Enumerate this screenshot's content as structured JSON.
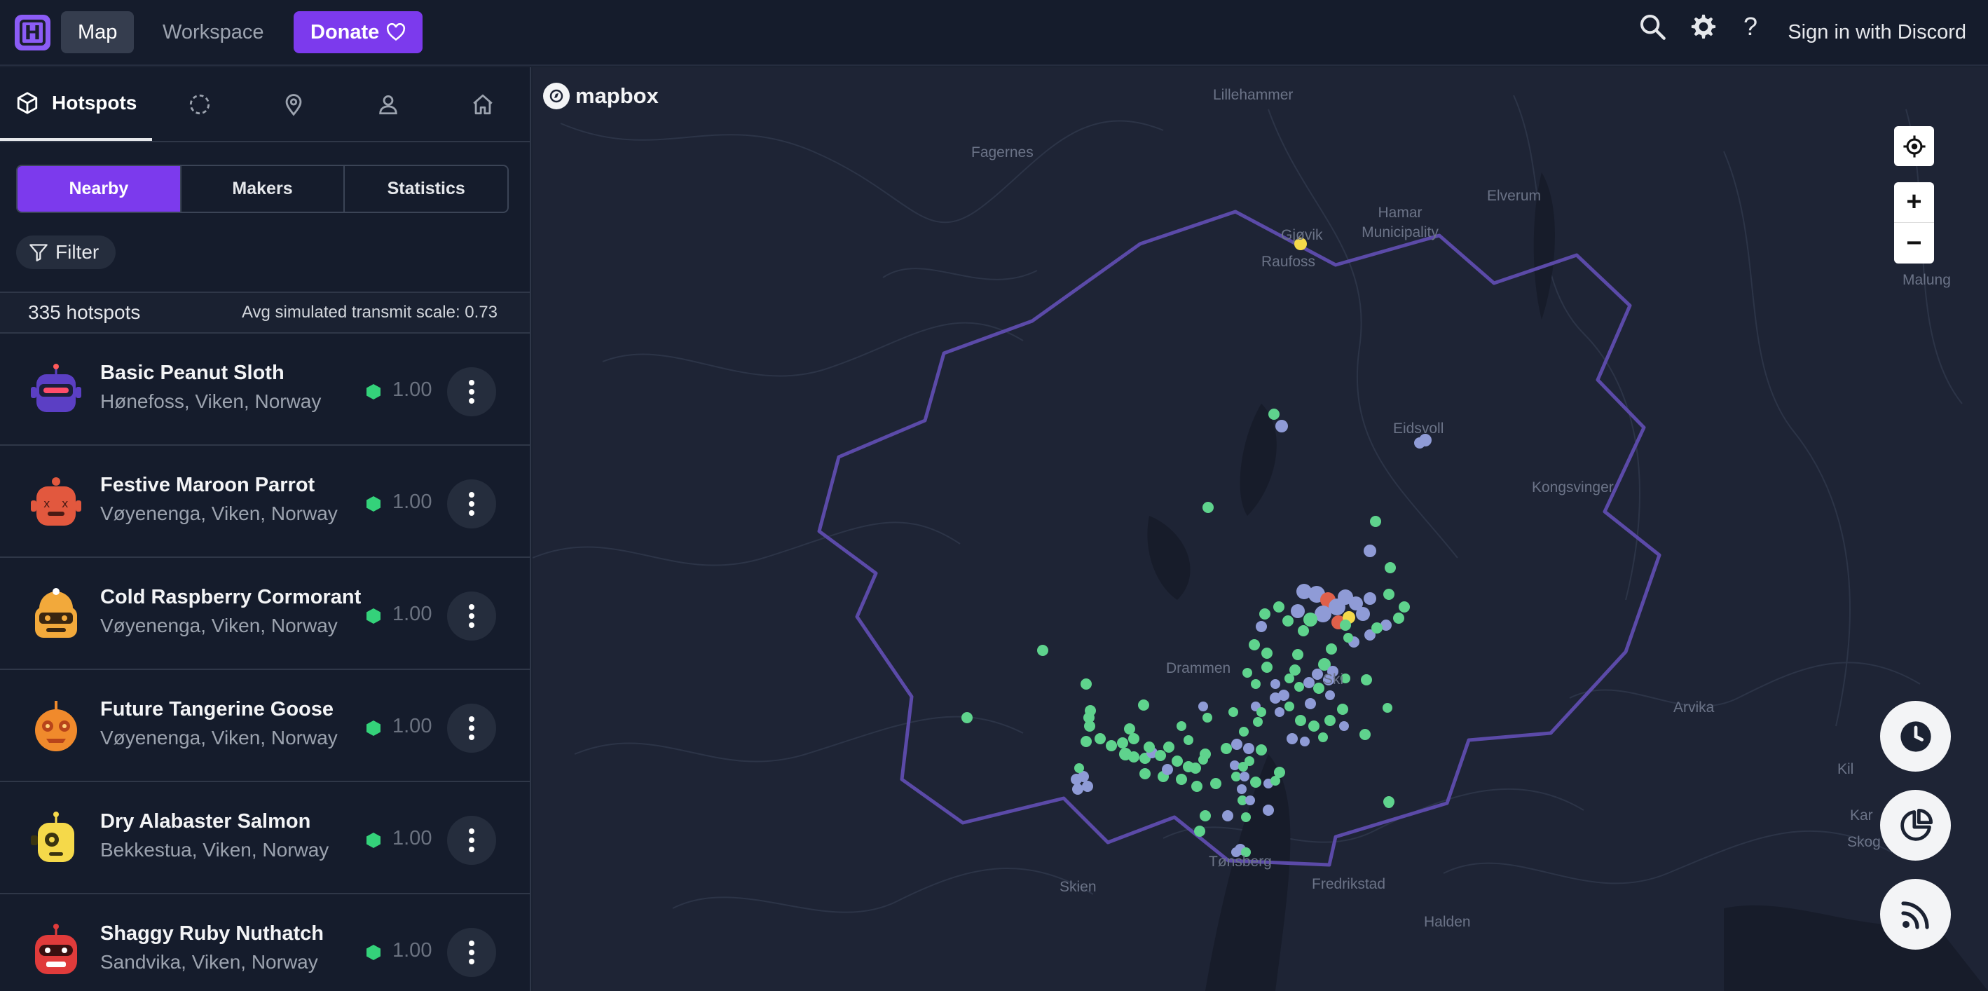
{
  "topbar": {
    "logo_letter": "H",
    "nav_map": "Map",
    "nav_workspace": "Workspace",
    "nav_donate": "Donate",
    "sign_in": "Sign in with Discord",
    "icons": [
      "search-icon",
      "gear-icon",
      "help-icon"
    ]
  },
  "sidebar": {
    "tabs": [
      {
        "icon": "cube-icon",
        "label": "Hotspots",
        "active": true
      },
      {
        "icon": "selection-icon"
      },
      {
        "icon": "location-pin-icon"
      },
      {
        "icon": "user-icon"
      },
      {
        "icon": "home-icon"
      }
    ],
    "segments": [
      "Nearby",
      "Makers",
      "Statistics"
    ],
    "active_segment": "Nearby",
    "filter_label": "Filter",
    "hotspot_count": "335 hotspots",
    "avg_scale": "Avg simulated transmit scale: 0.73",
    "hotspots": [
      {
        "name": "Basic Peanut Sloth",
        "location": "Hønefoss, Viken, Norway",
        "scale": "1.00",
        "avatar_color": "#5b3fc4"
      },
      {
        "name": "Festive Maroon Parrot",
        "location": "Vøyenenga, Viken, Norway",
        "scale": "1.00",
        "avatar_color": "#e2583e"
      },
      {
        "name": "Cold Raspberry Cormorant",
        "location": "Vøyenenga, Viken, Norway",
        "scale": "1.00",
        "avatar_color": "#f2a93b"
      },
      {
        "name": "Future Tangerine Goose",
        "location": "Vøyenenga, Viken, Norway",
        "scale": "1.00",
        "avatar_color": "#f08a2c"
      },
      {
        "name": "Dry Alabaster Salmon",
        "location": "Bekkestua, Viken, Norway",
        "scale": "1.00",
        "avatar_color": "#f5d94a"
      },
      {
        "name": "Shaggy Ruby Nuthatch",
        "location": "Sandvika, Viken, Norway",
        "scale": "1.00",
        "avatar_color": "#e03b3b"
      }
    ]
  },
  "map": {
    "attribution": "mapbox",
    "places": [
      "Lillehammer",
      "Fagernes",
      "Hamar Municipality",
      "Elverum",
      "Gjøvik",
      "Raufoss",
      "Malung",
      "Eidsvoll",
      "Kongsvinger",
      "Drammen",
      "Ski",
      "Arvika",
      "Kil",
      "Kar",
      "Skog",
      "Tønsberg",
      "Fredrikstad",
      "Skien",
      "Halden"
    ],
    "colors": {
      "boundary": "#5b4aa8",
      "hotspot_green": "#5fd38d",
      "hotspot_blue": "#8f9bd6",
      "hotspot_yellow": "#f5d94a",
      "hotspot_red": "#e0604a"
    },
    "controls": [
      "geolocate-icon",
      "zoom-in",
      "zoom-out"
    ],
    "fab_icons": [
      "clock-icon",
      "pie-chart-icon",
      "rss-icon"
    ]
  }
}
